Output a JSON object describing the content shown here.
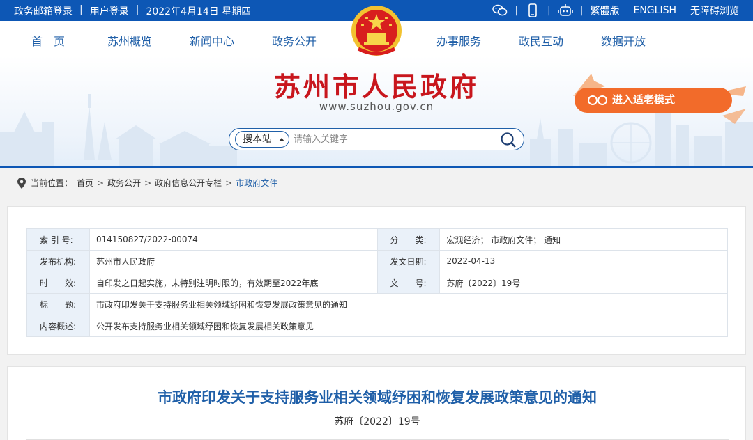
{
  "topbar": {
    "links": [
      "政务邮箱登录",
      "用户登录"
    ],
    "date": "2022年4月14日 星期四",
    "sep": "|",
    "lang_traditional": "繁體版",
    "lang_english": "ENGLISH",
    "accessibility": "无障碍浏览"
  },
  "nav": {
    "items": [
      "首　页",
      "苏州概览",
      "新闻中心",
      "政务公开",
      "办事服务",
      "政民互动",
      "数据开放"
    ]
  },
  "banner": {
    "title": "苏州市人民政府",
    "url": "www.suzhou.gov.cn",
    "elder_mode": "进入适老模式"
  },
  "search": {
    "scope": "搜本站",
    "placeholder": "请输入关键字"
  },
  "breadcrumb": {
    "label": "当前位置：",
    "items": [
      "首页",
      "政务公开",
      "政府信息公开专栏",
      "市政府文件"
    ],
    "gt": ">"
  },
  "meta": {
    "index_label": "索 引 号:",
    "index_value": "014150827/2022-00074",
    "category_label": "分　　类:",
    "category_value": "宏观经济；  市政府文件；  通知",
    "issuer_label": "发布机构:",
    "issuer_value": "苏州市人民政府",
    "date_label": "发文日期:",
    "date_value": "2022-04-13",
    "validity_label": "时　　效:",
    "validity_value": "自印发之日起实施，未特别注明时限的，有效期至2022年底",
    "docno_label": "文　　号:",
    "docno_value": "苏府〔2022〕19号",
    "title_label": "标　　题:",
    "title_value": "市政府印发关于支持服务业相关领域纾困和恢复发展政策意见的通知",
    "summary_label": "内容概述:",
    "summary_value": "公开发布支持服务业相关领域纾困和恢复发展相关政策意见"
  },
  "article": {
    "title": "市政府印发关于支持服务业相关领域纾困和恢复发展政策意见的通知",
    "doc_no": "苏府〔2022〕19号"
  },
  "colors": {
    "brand_blue": "#0d57b5",
    "title_red": "#c8161d",
    "elder_orange": "#f26b2a"
  }
}
